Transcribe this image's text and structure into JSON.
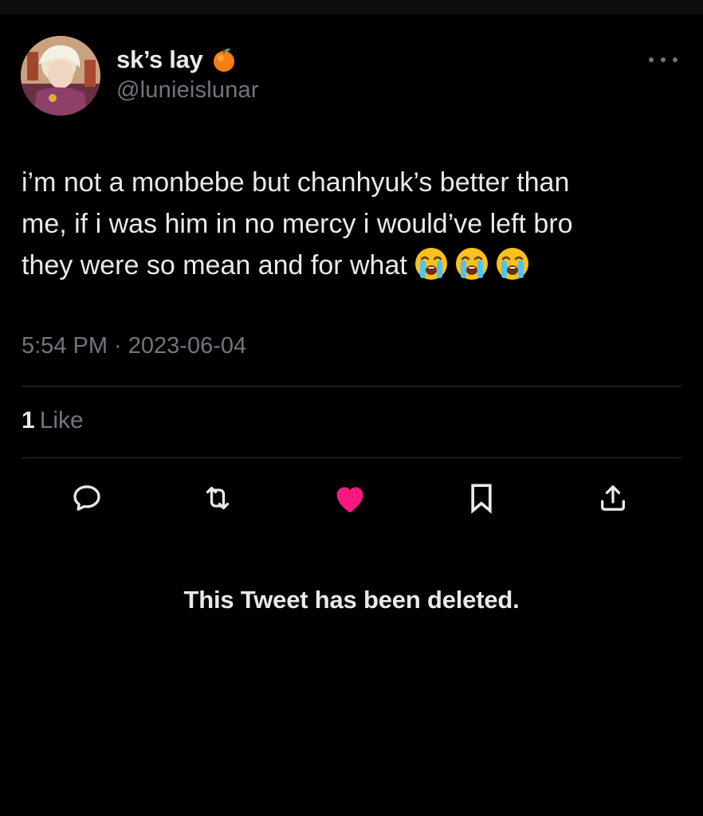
{
  "author": {
    "display_name": "sk’s lay",
    "handle": "@lunieislunar",
    "name_emoji": "orange-icon"
  },
  "tweet": {
    "text": "i’m not a monbebe but chanhyuk’s better than\nme, if i was him in no mercy i would’ve left bro\nthey were so mean and for what",
    "trailing_emojis": [
      "loudly-crying-face-icon",
      "loudly-crying-face-icon",
      "loudly-crying-face-icon"
    ],
    "timestamp": "5:54 PM · 2023-06-04"
  },
  "stats": {
    "likes_count": "1",
    "likes_label": "Like"
  },
  "actions": [
    "reply-icon",
    "retweet-icon",
    "like-icon",
    "bookmark-icon",
    "share-icon"
  ],
  "colors": {
    "background": "#000000",
    "primary_text": "#e7e9ea",
    "secondary_text": "#71767b",
    "divider": "#2f3336",
    "like_active": "#f91880"
  },
  "notice": {
    "text": "This Tweet has been deleted."
  }
}
